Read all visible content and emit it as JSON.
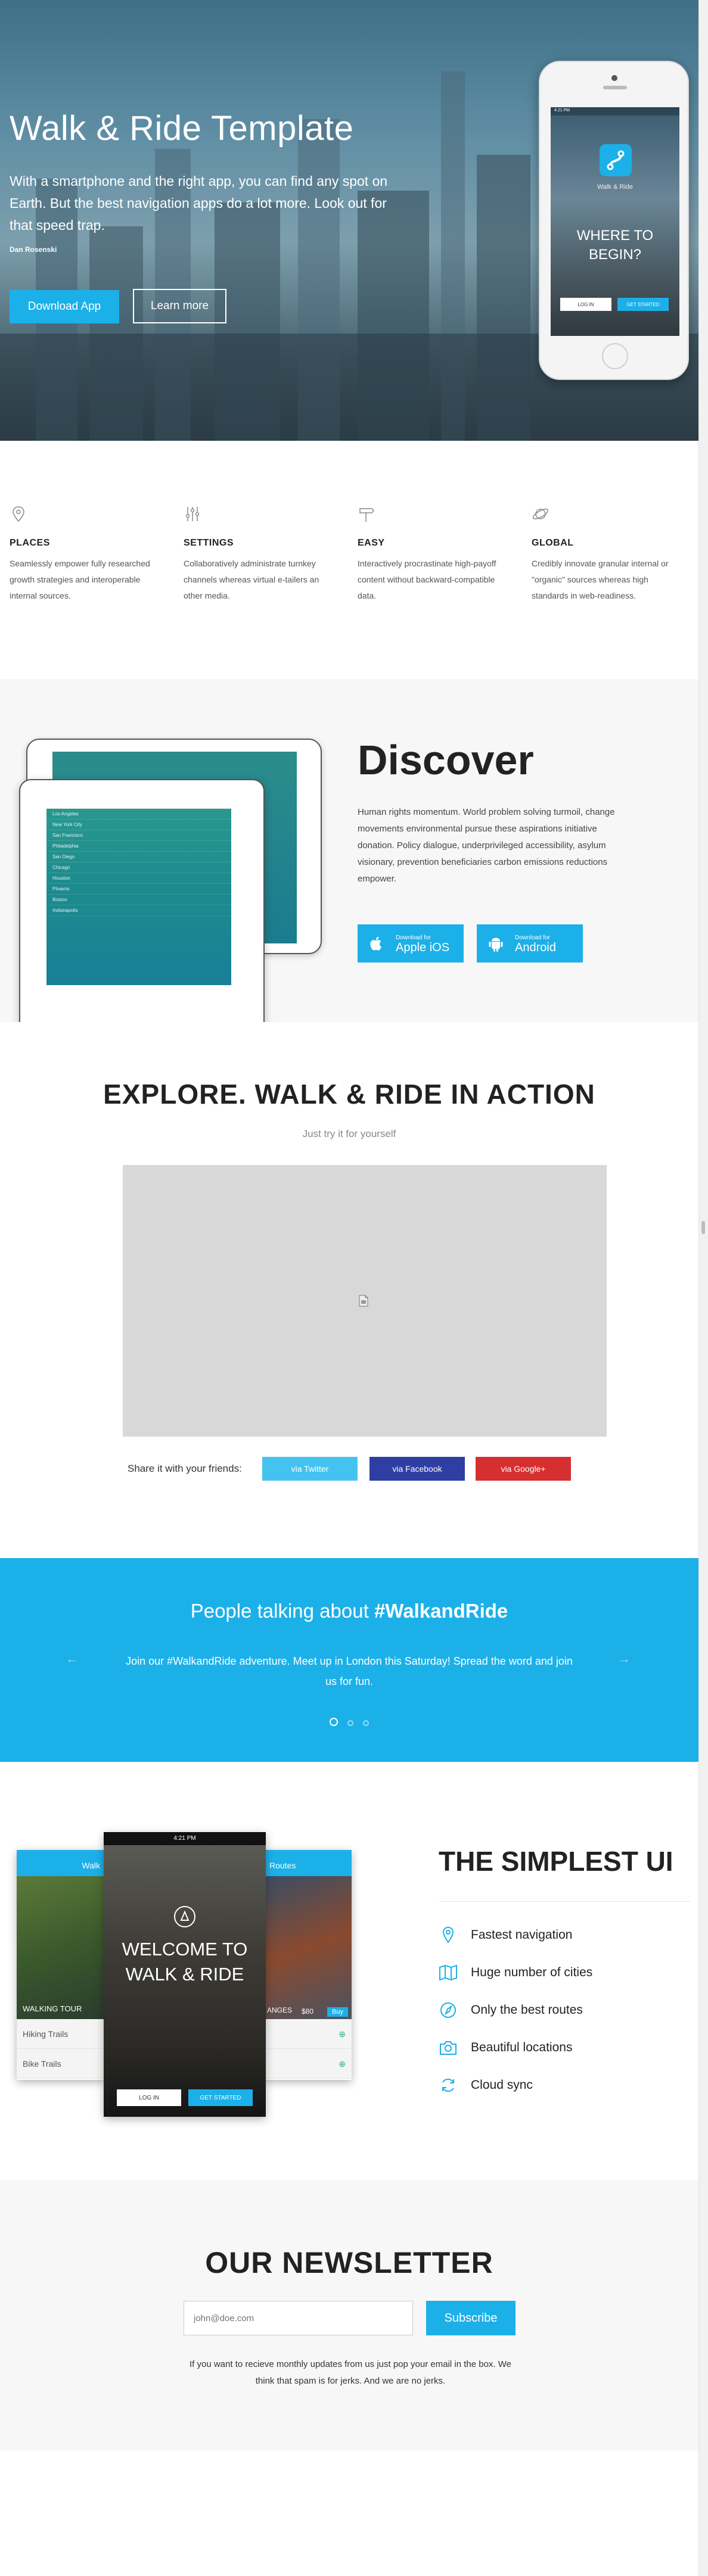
{
  "colors": {
    "accent": "#1cb0e8",
    "twitter": "#45c3f0",
    "facebook": "#2e3ea3",
    "google": "#d52f2f",
    "heading": "#222222"
  },
  "hero": {
    "title": "Walk & Ride Template",
    "lead": "With a smartphone and the right app, you can find any spot on Earth. But the best navigation apps do a lot more. Look out for that speed trap.",
    "author": "Dan Rosenski",
    "primary_btn": "Download App",
    "secondary_btn": "Learn more",
    "phone": {
      "time": "4:21 PM",
      "app_name": "Walk & Ride",
      "question": "WHERE TO BEGIN?",
      "login_btn": "LOG IN",
      "start_btn": "GET STARTED"
    }
  },
  "features": [
    {
      "icon": "location-pin-icon",
      "title": "PLACES",
      "text": "Seamlessly empower fully researched growth strategies and interoperable internal sources."
    },
    {
      "icon": "sliders-icon",
      "title": "SETTINGS",
      "text": "Collaboratively administrate turnkey channels whereas virtual e-tailers an other media."
    },
    {
      "icon": "signpost-icon",
      "title": "EASY",
      "text": "Interactively procrastinate high-payoff content without backward-compatible data."
    },
    {
      "icon": "planet-icon",
      "title": "GLOBAL",
      "text": "Credibly innovate granular internal or \"organic\" sources whereas high standards in web-readiness."
    }
  ],
  "discover": {
    "title": "Discover",
    "text": "Human rights momentum. World problem solving turmoil, change movements environmental pursue these aspirations initiative donation. Policy dialogue, underprivileged accessibility, asylum visionary, prevention beneficiaries carbon emissions reductions empower.",
    "ios_small": "Download for",
    "ios_big": "Apple iOS",
    "android_small": "Download for",
    "android_big": "Android",
    "tablet_cities": [
      "Los Angeles",
      "New York City",
      "San Francisco",
      "Philadelphia",
      "San Diego",
      "Chicago",
      "Houston",
      "Phoenix",
      "Boston",
      "Indianapolis"
    ]
  },
  "explore": {
    "title": "EXPLORE. WALK & RIDE IN ACTION",
    "subtitle": "Just try it for yourself",
    "share_label": "Share it with your friends:",
    "twitter": "via Twitter",
    "facebook": "via Facebook",
    "google": "via Google+"
  },
  "testimonial": {
    "heading_prefix": "People talking about ",
    "heading_tag": "#WalkandRide",
    "quote": "Join our #WalkandRide adventure. Meet up in London this Saturday! Spread the word and join us for fun.",
    "prev": "←",
    "next": "→"
  },
  "simple_ui": {
    "title": "THE SIMPLEST UI",
    "items": [
      {
        "icon": "map-pin-icon",
        "label": "Fastest navigation"
      },
      {
        "icon": "map-icon",
        "label": "Huge number of cities"
      },
      {
        "icon": "compass-icon",
        "label": "Only the best routes"
      },
      {
        "icon": "camera-icon",
        "label": "Beautiful locations"
      },
      {
        "icon": "sync-icon",
        "label": "Cloud sync"
      }
    ],
    "left_phone": {
      "header": "Walk",
      "overlay": "WALKING TOUR",
      "rows": [
        "Hiking Trails",
        "Bike Trails"
      ]
    },
    "center_phone": {
      "status": "4:21 PM",
      "welcome": "WELCOME TO WALK & RIDE",
      "login_btn": "LOG IN",
      "start_btn": "GET STARTED"
    },
    "right_phone": {
      "header": "Routes",
      "price": "$80",
      "buy": "Buy",
      "label": "ANGES"
    }
  },
  "newsletter": {
    "title": "OUR NEWSLETTER",
    "placeholder": "john@doe.com",
    "button": "Subscribe",
    "note": "If you want to recieve monthly updates from us just pop your email in the box. We think that spam is for jerks. And we are no jerks."
  }
}
